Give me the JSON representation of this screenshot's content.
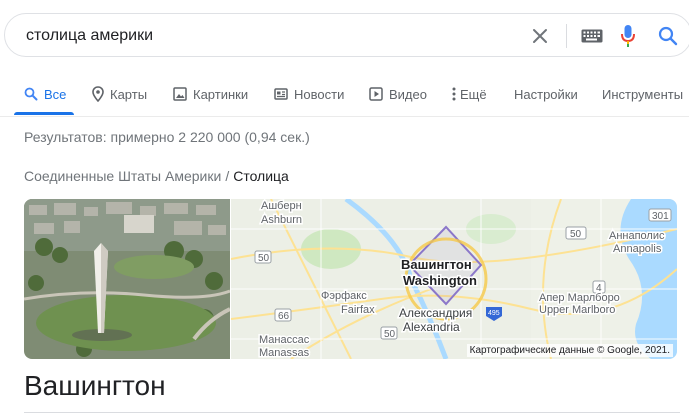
{
  "search": {
    "query": "столица америки"
  },
  "tabs": [
    {
      "label": "Все",
      "icon": "search-icon"
    },
    {
      "label": "Карты",
      "icon": "map-pin-icon"
    },
    {
      "label": "Картинки",
      "icon": "image-icon"
    },
    {
      "label": "Новости",
      "icon": "news-icon"
    },
    {
      "label": "Видео",
      "icon": "video-icon"
    },
    {
      "label": "Ещё",
      "icon": "more-vert-icon"
    },
    {
      "label": "Настройки"
    },
    {
      "label": "Инструменты"
    }
  ],
  "results": {
    "stats": "Результатов: примерно 2 220 000 (0,94 сек.)"
  },
  "knowledge": {
    "breadcrumb_parent": "Соединенные Штаты Америки",
    "breadcrumb_sep": "/",
    "breadcrumb_current": "Столица",
    "title": "Вашингтон",
    "map": {
      "city_ru": "Вашингтон",
      "city_en": "Washington",
      "copyright": "Картографические данные © Google, 2021.",
      "places": [
        {
          "ru": "Ашберн",
          "en": "Ashburn"
        },
        {
          "ru": "Фэрфакс",
          "en": "Fairfax"
        },
        {
          "ru": "Александрия",
          "en": "Alexandria"
        },
        {
          "ru": "Манассас",
          "en": "Manassas"
        },
        {
          "ru": "Аннаполис",
          "en": "Annapolis"
        },
        {
          "ru": "Апер Марлборо",
          "en": "Upper Marlboro"
        }
      ],
      "route_shields": [
        "50",
        "50",
        "66",
        "495",
        "50",
        "4",
        "301"
      ],
      "interstate_shield": "495"
    }
  },
  "colors": {
    "accent": "#1a73e8",
    "muted": "#70757a",
    "text": "#202124",
    "mic_red": "#ea4335"
  }
}
